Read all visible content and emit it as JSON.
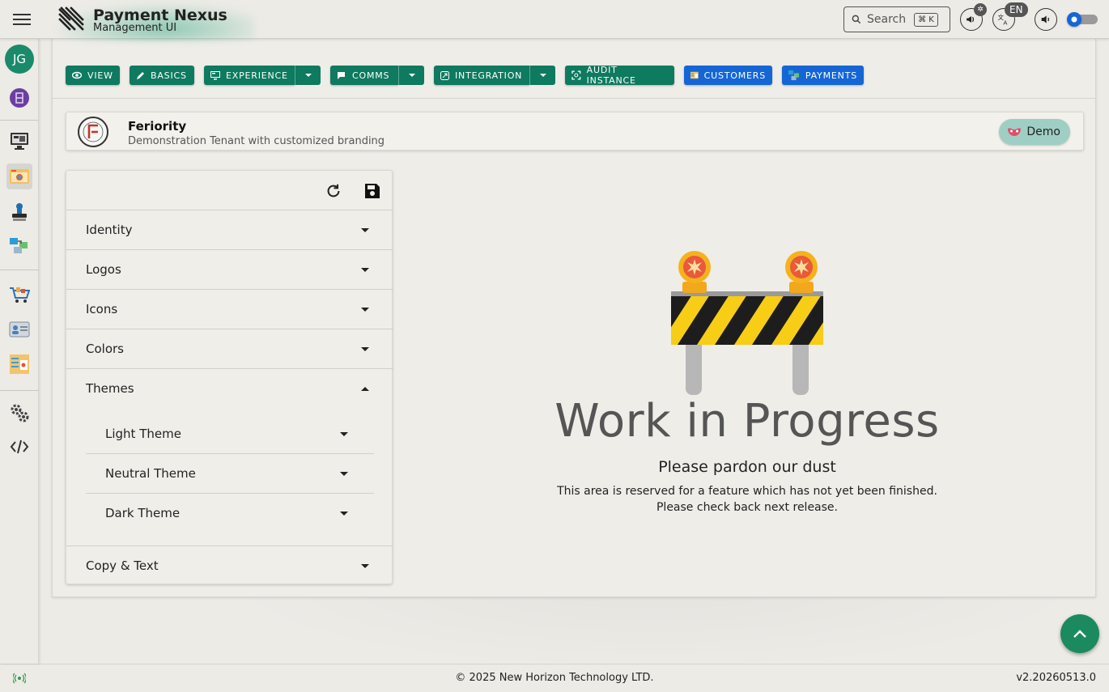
{
  "header": {
    "brand_title": "Payment Nexus",
    "brand_subtitle": "Management UI",
    "search_placeholder": "Search",
    "search_shortcut": "⌘ K",
    "language": "EN"
  },
  "sidebar": {
    "avatar_initials": "JG",
    "items": [
      "monitor",
      "branding",
      "stamp",
      "payments-flow",
      "cart",
      "id-card",
      "catalog",
      "settings",
      "code"
    ]
  },
  "toolbar": {
    "buttons": [
      {
        "label": "VIEW"
      },
      {
        "label": "BASICS"
      },
      {
        "label": "EXPERIENCE"
      },
      {
        "label": "COMMS"
      },
      {
        "label": "INTEGRATION"
      },
      {
        "label": "AUDIT INSTANCE"
      },
      {
        "label": "CUSTOMERS"
      },
      {
        "label": "PAYMENTS"
      }
    ]
  },
  "tenant": {
    "name": "Feriority",
    "description": "Demonstration Tenant with customized branding",
    "env_label": "Demo"
  },
  "accordion": {
    "sections": [
      {
        "label": "Identity"
      },
      {
        "label": "Logos"
      },
      {
        "label": "Icons"
      },
      {
        "label": "Colors"
      },
      {
        "label": "Themes"
      },
      {
        "label": "Copy & Text"
      }
    ],
    "theme_items": [
      {
        "label": "Light Theme"
      },
      {
        "label": "Neutral Theme"
      },
      {
        "label": "Dark Theme"
      }
    ]
  },
  "wip": {
    "title": "Work in Progress",
    "subtitle": "Please pardon our dust",
    "message_1": "This area is reserved for a feature which has not yet been finished.",
    "message_2": "Please check back next release."
  },
  "footer": {
    "copyright": "© 2025 New Horizon Technology LTD.",
    "version": "v2.20260513.0"
  },
  "colors": {
    "primary_green": "#0e7a5f",
    "accent_blue": "#1466d6",
    "avatar_green": "#1b8a6b"
  }
}
